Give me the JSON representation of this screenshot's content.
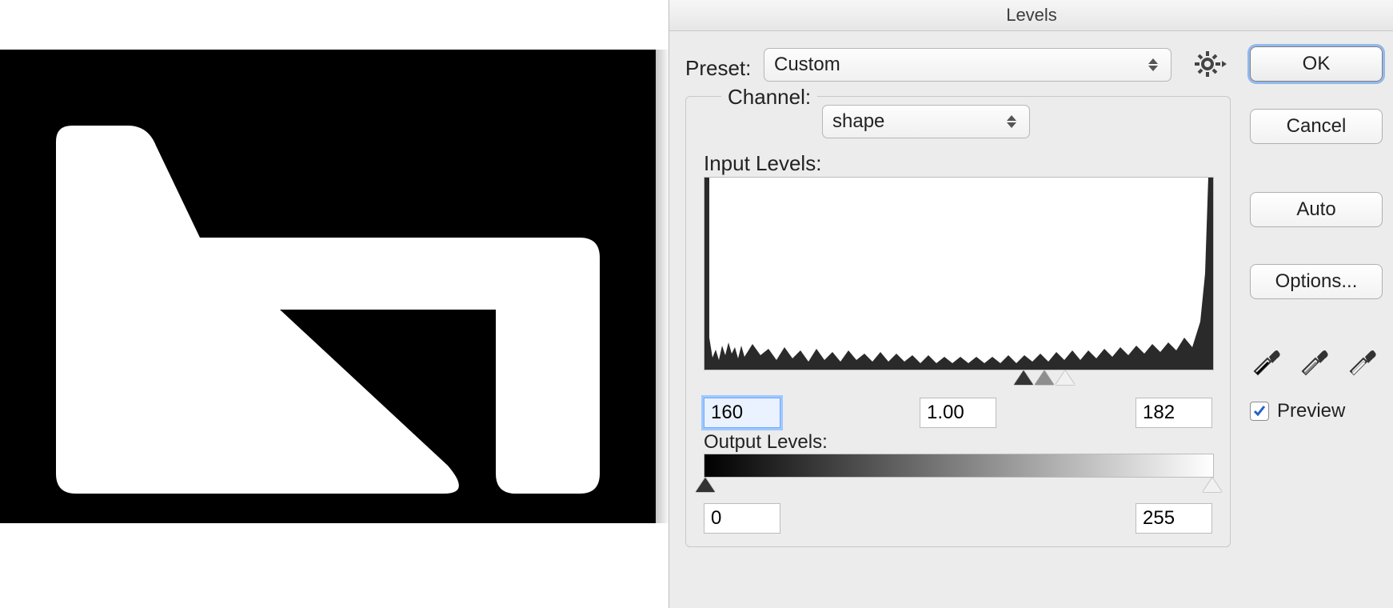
{
  "dialog": {
    "title": "Levels",
    "preset_label": "Preset:",
    "preset_value": "Custom",
    "channel_label": "Channel:",
    "channel_value": "shape",
    "input_label": "Input Levels:",
    "output_label": "Output Levels:",
    "input_black": "160",
    "input_gamma": "1.00",
    "input_white": "182",
    "output_black": "0",
    "output_white": "255",
    "buttons": {
      "ok": "OK",
      "cancel": "Cancel",
      "auto": "Auto",
      "options": "Options..."
    },
    "preview_label": "Preview",
    "preview_checked": true
  },
  "icons": {
    "gear": "gear-icon",
    "eyedropper_black": "eyedropper-black-icon",
    "eyedropper_gray": "eyedropper-gray-icon",
    "eyedropper_white": "eyedropper-white-icon"
  }
}
